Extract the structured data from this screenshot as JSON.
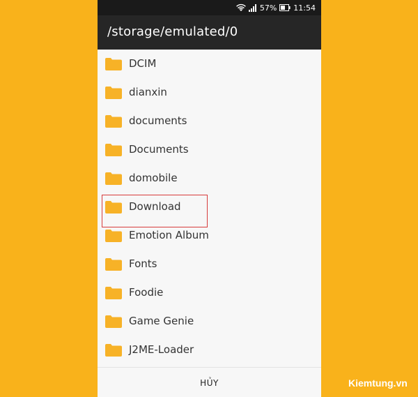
{
  "status_bar": {
    "battery_percent": "57%",
    "time": "11:54"
  },
  "header": {
    "path": "/storage/emulated/0"
  },
  "folders": [
    {
      "label": "DCIM"
    },
    {
      "label": "dianxin"
    },
    {
      "label": "documents"
    },
    {
      "label": "Documents"
    },
    {
      "label": "domobile"
    },
    {
      "label": "Download"
    },
    {
      "label": "Emotion Album"
    },
    {
      "label": "Fonts"
    },
    {
      "label": "Foodie"
    },
    {
      "label": "Game Genie"
    },
    {
      "label": "J2ME-Loader"
    }
  ],
  "footer": {
    "cancel_label": "HỦY"
  },
  "watermark": "Kiemtung.vn",
  "colors": {
    "background": "#F9B21B",
    "folder": "#F7B227",
    "highlight_border": "#D73B3B",
    "title_bar": "#262626"
  }
}
